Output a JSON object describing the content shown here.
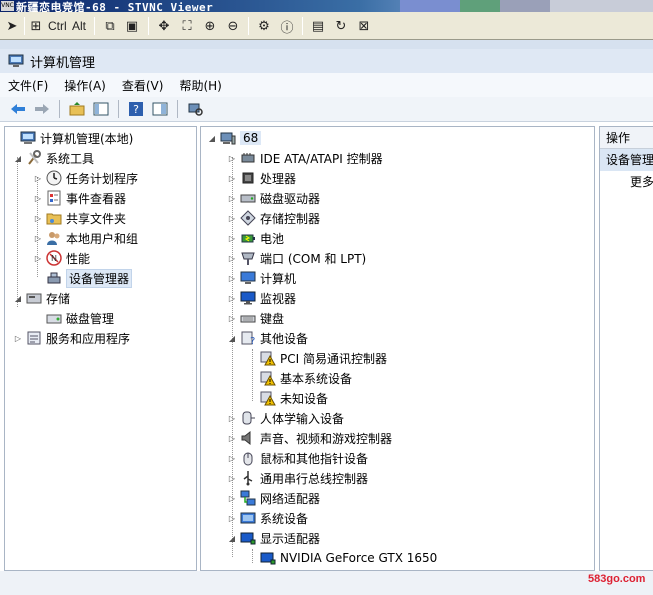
{
  "vnc": {
    "logo": "VNC",
    "title": "新疆恋电竞馆-68 - STVNC Viewer",
    "toolbar": {
      "ctrl_label": "Ctrl",
      "alt_label": "Alt"
    }
  },
  "window": {
    "title": "计算机管理"
  },
  "menu": [
    "文件(F)",
    "操作(A)",
    "查看(V)",
    "帮助(H)"
  ],
  "left_tree": {
    "root": "计算机管理(本地)",
    "system_tools": "系统工具",
    "task_scheduler": "任务计划程序",
    "event_viewer": "事件查看器",
    "shared_folders": "共享文件夹",
    "local_users": "本地用户和组",
    "performance": "性能",
    "device_manager": "设备管理器",
    "storage": "存储",
    "disk_mgmt": "磁盘管理",
    "services_apps": "服务和应用程序"
  },
  "devices": {
    "root": "68",
    "ide": "IDE ATA/ATAPI 控制器",
    "processor": "处理器",
    "disk_drives": "磁盘驱动器",
    "storage_ctrl": "存储控制器",
    "battery": "电池",
    "ports": "端口 (COM 和 LPT)",
    "computer": "计算机",
    "monitors": "监视器",
    "keyboard": "键盘",
    "other": "其他设备",
    "pci": "PCI 简易通讯控制器",
    "base_sys": "基本系统设备",
    "unknown": "未知设备",
    "hid": "人体学输入设备",
    "sound": "声音、视频和游戏控制器",
    "mouse": "鼠标和其他指针设备",
    "usb": "通用串行总线控制器",
    "network": "网络适配器",
    "system": "系统设备",
    "display": "显示适配器",
    "gpu": "NVIDIA GeForce GTX 1650"
  },
  "actions": {
    "header": "操作",
    "selected": "设备管理",
    "more": "更多"
  },
  "watermark": "583go.com",
  "colors": {
    "accent": "#3a6ea5",
    "warning": "#f0c000",
    "selection": "#dde8f6"
  }
}
